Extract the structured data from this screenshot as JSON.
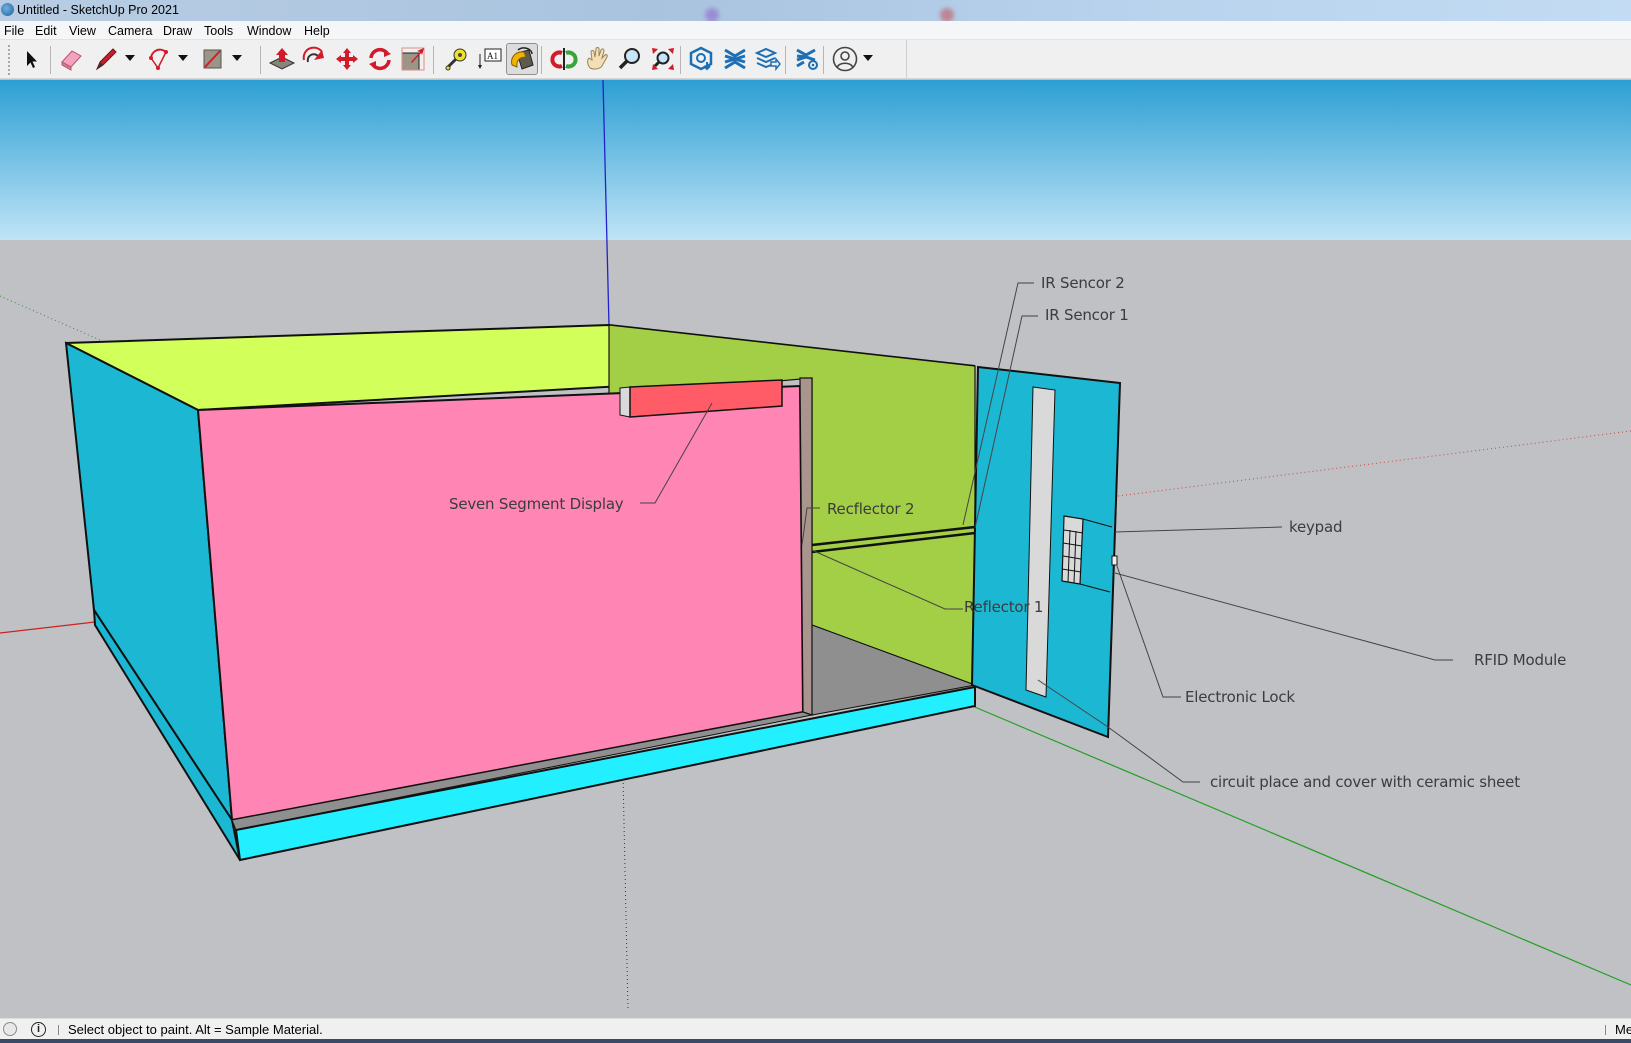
{
  "window": {
    "title": "Untitled - SketchUp Pro 2021"
  },
  "menu": {
    "items": [
      "File",
      "Edit",
      "View",
      "Camera",
      "Draw",
      "Tools",
      "Window",
      "Help"
    ]
  },
  "toolbar": {
    "tools": [
      {
        "name": "select",
        "icon": "arrow-cursor-icon"
      },
      {
        "name": "eraser",
        "icon": "eraser-icon"
      },
      {
        "name": "line",
        "icon": "pencil-icon",
        "has_dropdown": true
      },
      {
        "name": "arc",
        "icon": "arc-icon",
        "has_dropdown": true
      },
      {
        "name": "rectangle",
        "icon": "rectangle-icon",
        "has_dropdown": true
      },
      {
        "name": "push-pull",
        "icon": "push-pull-icon"
      },
      {
        "name": "offset",
        "icon": "offset-icon"
      },
      {
        "name": "move",
        "icon": "move-icon"
      },
      {
        "name": "rotate",
        "icon": "rotate-icon"
      },
      {
        "name": "scale",
        "icon": "scale-icon"
      },
      {
        "name": "tape-measure",
        "icon": "tape-measure-icon"
      },
      {
        "name": "text",
        "icon": "text-icon",
        "glyph": "A1"
      },
      {
        "name": "paint-bucket",
        "icon": "paint-bucket-icon",
        "active": true
      },
      {
        "name": "orbit",
        "icon": "orbit-icon"
      },
      {
        "name": "pan",
        "icon": "pan-hand-icon"
      },
      {
        "name": "zoom",
        "icon": "zoom-icon"
      },
      {
        "name": "zoom-extents",
        "icon": "zoom-extents-icon"
      },
      {
        "name": "3d-warehouse",
        "icon": "warehouse-icon"
      },
      {
        "name": "extension-warehouse",
        "icon": "extension-warehouse-icon"
      },
      {
        "name": "layout",
        "icon": "send-to-layout-icon"
      },
      {
        "name": "extension-manager",
        "icon": "extension-manager-icon"
      },
      {
        "name": "account",
        "icon": "user-account-icon",
        "has_dropdown": true
      }
    ]
  },
  "model": {
    "colors": {
      "sky_top": "#2d9fd4",
      "sky_bottom": "#bfe3f5",
      "ground": "#c0c1c5",
      "top_face": "#d2ff5a",
      "inner_wall": "#a2cf45",
      "side_face": "#1cb7d2",
      "front_face": "#ff85b4",
      "base": "#22efff",
      "display": "#ff5c67",
      "partition": "#a9958d",
      "floor": "#8f8f8f",
      "strip": "#d9d9d9"
    }
  },
  "annotations": [
    {
      "id": "seven-segment-display",
      "text": "Seven Segment Display"
    },
    {
      "id": "reflector-2",
      "text": "Recflector 2"
    },
    {
      "id": "ir-sensor-2",
      "text": "IR Sencor 2"
    },
    {
      "id": "ir-sensor-1",
      "text": "IR Sencor 1"
    },
    {
      "id": "reflector-1",
      "text": "Reflector 1"
    },
    {
      "id": "keypad",
      "text": "keypad"
    },
    {
      "id": "rfid-module",
      "text": "RFID Module"
    },
    {
      "id": "electronic-lock",
      "text": "Electronic Lock"
    },
    {
      "id": "circuit-place",
      "text": "circuit place and cover with ceramic sheet"
    }
  ],
  "status": {
    "message": "Select object to paint. Alt = Sample Material.",
    "measurements_label": "Me"
  }
}
